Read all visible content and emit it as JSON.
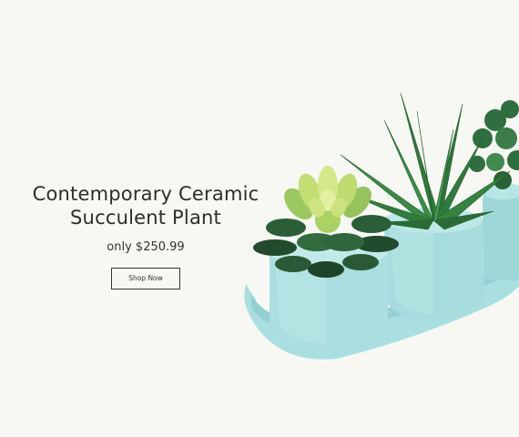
{
  "hero": {
    "title_line1": "Contemporary Ceramic",
    "title_line2": "Succulent Plant",
    "price": "only $250.99",
    "cta_label": "Shop Now"
  },
  "colors": {
    "background": "#f7f8f3",
    "ceramic": "#a8dfe0",
    "text": "#2d2d2d",
    "succulent_light": "#c9e06b",
    "leaf_dark": "#2f5f3a"
  }
}
